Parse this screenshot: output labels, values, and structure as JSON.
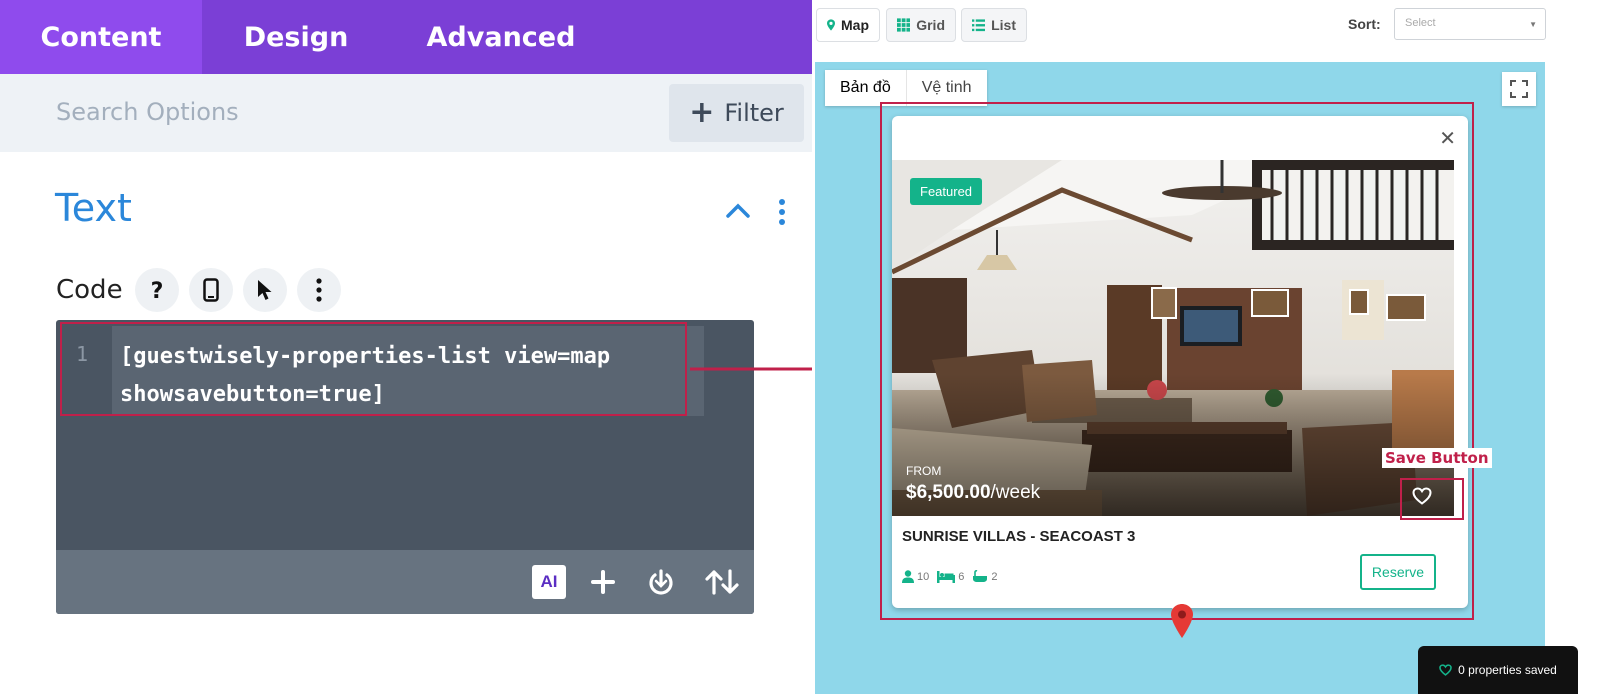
{
  "builder": {
    "tabs": [
      {
        "label": "Content",
        "active": true
      },
      {
        "label": "Design",
        "active": false
      },
      {
        "label": "Advanced",
        "active": false
      }
    ],
    "search": {
      "placeholder": "Search Options"
    },
    "filter_label": "Filter",
    "section_title": "Text",
    "code_label": "Code",
    "editor": {
      "line_number": "1",
      "code": "[guestwisely-properties-list view=map showsavebutton=true]",
      "ai_label": "AI"
    }
  },
  "listing": {
    "view_buttons": [
      {
        "label": "Map",
        "icon": "map-pin-icon",
        "active": true
      },
      {
        "label": "Grid",
        "icon": "grid-icon",
        "active": false
      },
      {
        "label": "List",
        "icon": "list-icon",
        "active": false
      }
    ],
    "sort_label": "Sort:",
    "sort_placeholder": "Select",
    "map_tabs": [
      {
        "label": "Bản đồ",
        "active": true
      },
      {
        "label": "Vệ tinh",
        "active": false
      }
    ],
    "card": {
      "badge": "Featured",
      "price_from": "FROM",
      "price": "$6,500.00",
      "price_period": "/week",
      "title": "SUNRISE VILLAS - SEACOAST 3",
      "guests": "10",
      "bedrooms": "6",
      "bathrooms": "2",
      "reserve_label": "Reserve"
    },
    "save_annotation": "Save Button",
    "saved_bar": "0 properties saved"
  },
  "colors": {
    "purple_tab_bar": "#7b3fd6",
    "purple_active_tab": "#8f4bed",
    "accent_blue": "#2b87da",
    "teal": "#14b38a",
    "highlight_red": "#c0204a",
    "map_water": "#8fd7ea"
  }
}
